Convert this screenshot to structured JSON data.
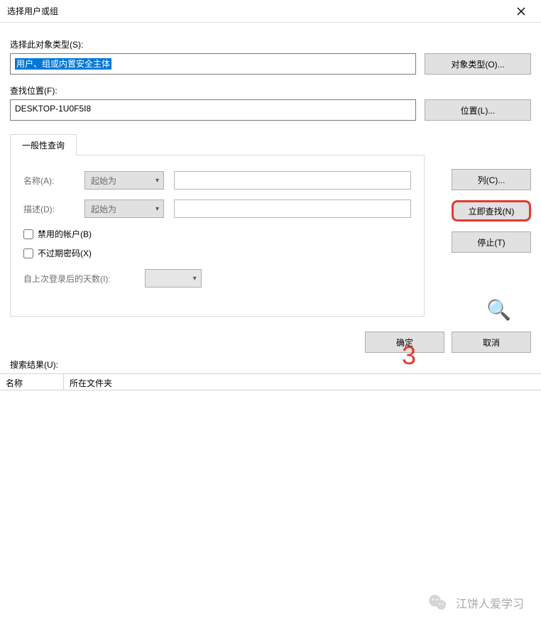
{
  "titlebar": {
    "title": "选择用户或组"
  },
  "labels": {
    "object_type": "选择此对象类型(S):",
    "location": "查找位置(F):",
    "search_results": "搜索结果(U):"
  },
  "fields": {
    "object_type_value": "用户、组或内置安全主体",
    "location_value": "DESKTOP-1U0F5I8"
  },
  "buttons": {
    "object_types": "对象类型(O)...",
    "locations": "位置(L)...",
    "columns": "列(C)...",
    "find_now": "立即查找(N)",
    "stop": "停止(T)",
    "ok": "确定",
    "cancel": "取消"
  },
  "tab": {
    "label": "一般性查询"
  },
  "query": {
    "name_label": "名称(A):",
    "desc_label": "描述(D):",
    "name_op": "起始为",
    "desc_op": "起始为",
    "disabled_accounts": "禁用的帐户(B)",
    "non_expiring": "不过期密码(X)",
    "days_since": "自上次登录后的天数(I):"
  },
  "headers": {
    "name": "名称",
    "folder": "所在文件夹"
  },
  "annotation": {
    "number": "3"
  },
  "watermark": {
    "text": "江饼人爱学习"
  }
}
